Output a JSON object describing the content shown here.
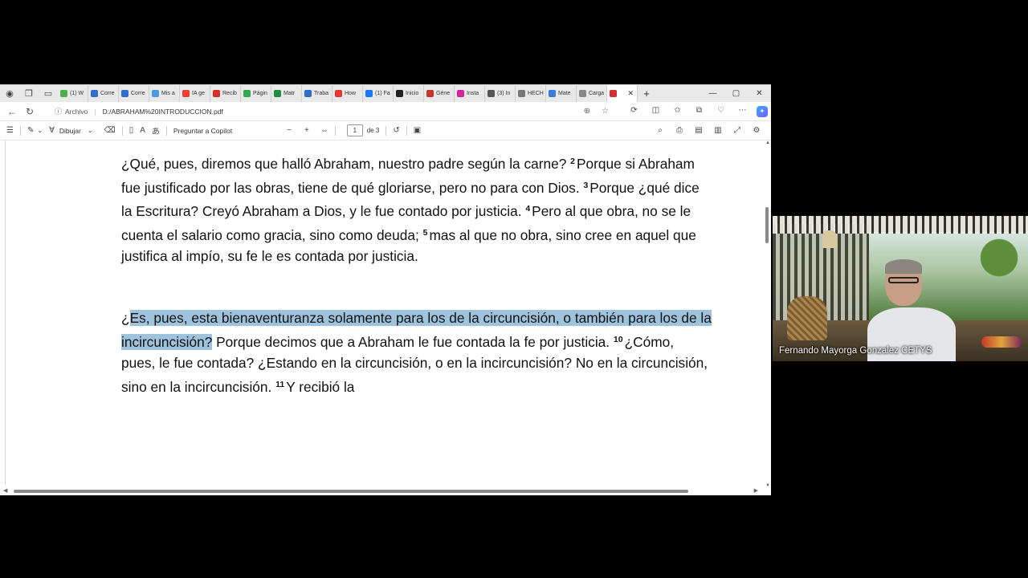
{
  "tabs": [
    {
      "label": "(1) W",
      "color": "#4caf50"
    },
    {
      "label": "Corre",
      "color": "#2f6fc8"
    },
    {
      "label": "Corre",
      "color": "#2f6fc8"
    },
    {
      "label": "Mis a",
      "color": "#4b9be0"
    },
    {
      "label": "IA ge",
      "color": "#ea4335"
    },
    {
      "label": "Recib",
      "color": "#d93025"
    },
    {
      "label": "Págin",
      "color": "#34a853"
    },
    {
      "label": "Matr",
      "color": "#1e8e3e"
    },
    {
      "label": "Traba",
      "color": "#2f6fc8"
    },
    {
      "label": "How",
      "color": "#e53935"
    },
    {
      "label": "(1) Fa",
      "color": "#1877f2"
    },
    {
      "label": "Inicio",
      "color": "#222222"
    },
    {
      "label": "Géne",
      "color": "#c0392b"
    },
    {
      "label": "Insta",
      "color": "#d6249f"
    },
    {
      "label": "(3) In",
      "color": "#555555"
    },
    {
      "label": "HECH",
      "color": "#777777"
    },
    {
      "label": "Mate",
      "color": "#3b7dd8"
    },
    {
      "label": "Carga",
      "color": "#888888"
    }
  ],
  "active_tab": {
    "label": "",
    "close": "✕"
  },
  "window_controls": {
    "new_tab": "+",
    "minimize": "—",
    "maximize": "▢",
    "close": "✕"
  },
  "address": {
    "info_icon": "ⓘ",
    "scheme_label": "Archivo",
    "separator": "|",
    "url": "D:/ABRAHAM%20INTRODUCCION.pdf",
    "zoom_icon": "⊕",
    "star_icon": "☆"
  },
  "pdf_toolbar": {
    "highlight_icon": "✎",
    "draw_icon": "∀",
    "draw_label": "Dibujar",
    "dropdown": "⌄",
    "erase_icon": "⌫",
    "read_aloud_icon": "A",
    "translate_icon": "あ",
    "copilot_label": "Preguntar a Copilot",
    "zoom_out": "−",
    "zoom_in": "+",
    "fit_icon": "⇔",
    "page_value": "1",
    "page_total": "de 3",
    "rotate_icon": "↺",
    "view_icon": "▣",
    "search_icon": "⌕",
    "print_icon": "⎙",
    "save_icon": "▤",
    "saveas_icon": "▥",
    "fullscreen_icon": "⤢",
    "settings_icon": "⚙"
  },
  "document": {
    "para1": {
      "s1": "¿Qué, pues, diremos que halló Abraham, nuestro padre según la carne?",
      "v2": "2",
      "s2": "Porque si Abraham fue justificado por las obras, tiene de qué gloriarse, pero no para con Dios.",
      "v3": "3",
      "s3": "Porque ¿qué dice la Escritura? Creyó Abraham a Dios, y le fue contado por justicia.",
      "v4": "4",
      "s4": "Pero al que obra, no se le cuenta el salario como gracia, sino como deuda;",
      "v5": "5",
      "s5": "mas al que no obra, sino cree en aquel que justifica al impío, su fe le es contada por justicia."
    },
    "para2": {
      "lead": "¿",
      "highlighted": "Es, pues, esta bienaventuranza solamente para los de la circuncisión, o también para los de la incircuncisión?",
      "s1": " Porque decimos que a Abraham le fue contada la fe por justicia.",
      "v10": "10",
      "s2": "¿Cómo, pues, le fue contada? ¿Estando en la circuncisión, o en la incircuncisión? No en la circuncisión, sino en la incircuncisión.",
      "v11": "11",
      "s3": "Y recibió la"
    }
  },
  "scroll": {
    "vertical_position": 0.19,
    "horizontal_thumb_fraction": 0.88
  },
  "video": {
    "participant_name": "Fernando Mayorga Gonzalez CETYS"
  },
  "colors": {
    "highlight": "#9fc3dd",
    "tabstrip": "#e9e9ea",
    "accent": "#2fb0f0"
  }
}
